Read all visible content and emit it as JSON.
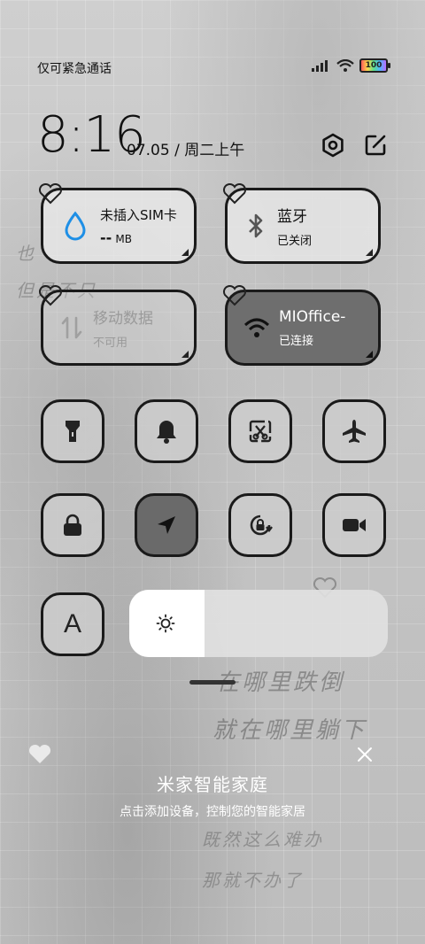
{
  "status_bar": {
    "carrier_text": "仅可紧急通话",
    "battery_level": "100"
  },
  "header": {
    "time": "8:16",
    "date": "07.05 / 周二上午"
  },
  "tiles": [
    {
      "title": "未插入SIM卡",
      "subtitle": "--",
      "unit": "MB"
    },
    {
      "title": "蓝牙",
      "subtitle": "已关闭"
    },
    {
      "title": "移动数据",
      "subtitle": "不可用"
    },
    {
      "title": "MIOffice-",
      "subtitle": "已连接"
    }
  ],
  "toggles_row1": [
    "flashlight-icon",
    "bell-icon",
    "screenshot-icon",
    "airplane-icon"
  ],
  "toggles_row2": [
    "lock-icon",
    "location-icon",
    "rotation-lock-icon",
    "video-icon"
  ],
  "font_toggle": "A",
  "brightness": {
    "level": 0.29
  },
  "mijia": {
    "title": "米家智能家庭",
    "subtitle": "点击添加设备，控制您的智能家居"
  },
  "wallpaper_text": {
    "line1": "在哪里跌倒",
    "line2": "就在哪里躺下",
    "line3": "既然这么难办",
    "line4": "那就不办了",
    "left1": "也",
    "left2": "但是不只"
  }
}
